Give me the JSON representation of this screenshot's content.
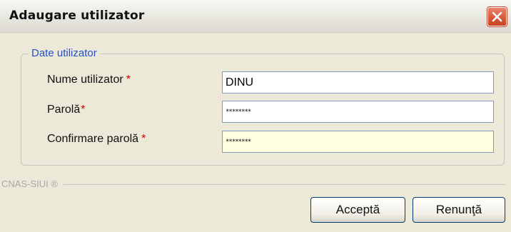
{
  "window": {
    "title": "Adaugare utilizator"
  },
  "group": {
    "legend": "Date utilizator"
  },
  "fields": {
    "username": {
      "label": "Nume utilizator",
      "required_mark": "*",
      "value": "DINU"
    },
    "password": {
      "label": "Parolă",
      "required_mark": "*",
      "value": "********"
    },
    "confirm_password": {
      "label": "Confirmare parolă",
      "required_mark": "*",
      "value": "********"
    }
  },
  "footer": {
    "brand": "CNAS-SIUI ®"
  },
  "buttons": {
    "accept": "Acceptă",
    "cancel": "Renunţă"
  },
  "colors": {
    "legend_text": "#2550c8",
    "required_mark": "#d40000",
    "focused_field_bg": "#ffffe1",
    "close_button": "#d9583b"
  },
  "icons": {
    "close": "close-icon"
  }
}
